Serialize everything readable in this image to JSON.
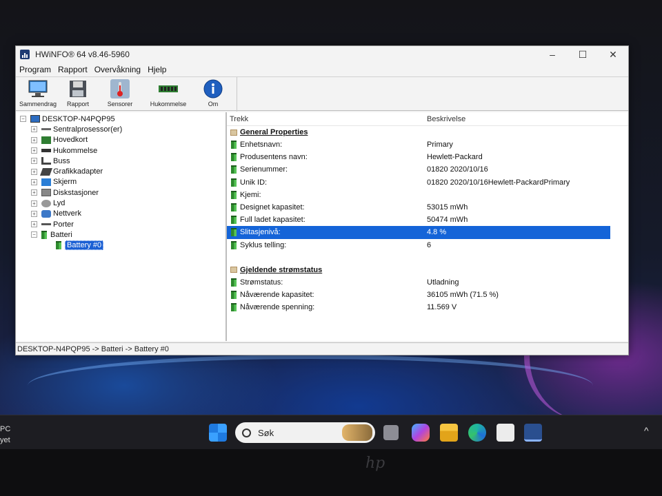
{
  "window": {
    "title": "HWiNFO® 64 v8.46-5960",
    "controls": {
      "minimize": "–",
      "maximize": "☐",
      "close": "✕"
    }
  },
  "menu": [
    "Program",
    "Rapport",
    "Overvåkning",
    "Hjelp"
  ],
  "toolbar": [
    {
      "label": "Sammendrag",
      "icon": "monitor-icon"
    },
    {
      "label": "Rapport",
      "icon": "floppy-disk-icon"
    },
    {
      "label": "Sensorer",
      "icon": "thermometer-icon"
    },
    {
      "label": "Hukommelse",
      "icon": "memory-module-icon"
    },
    {
      "label": "Om",
      "icon": "info-icon"
    }
  ],
  "tree": {
    "root": "DESKTOP-N4PQP95",
    "items": [
      {
        "label": "Sentralprosessor(er)",
        "icon": "cpu-icon"
      },
      {
        "label": "Hovedkort",
        "icon": "motherboard-icon"
      },
      {
        "label": "Hukommelse",
        "icon": "memory-icon"
      },
      {
        "label": "Buss",
        "icon": "bus-icon"
      },
      {
        "label": "Grafikkadapter",
        "icon": "gpu-icon"
      },
      {
        "label": "Skjerm",
        "icon": "display-icon"
      },
      {
        "label": "Diskstasjoner",
        "icon": "disk-icon"
      },
      {
        "label": "Lyd",
        "icon": "speaker-icon"
      },
      {
        "label": "Nettverk",
        "icon": "network-icon"
      },
      {
        "label": "Porter",
        "icon": "ports-icon"
      },
      {
        "label": "Batteri",
        "icon": "battery-icon"
      }
    ],
    "selected_child": "Battery #0"
  },
  "detail": {
    "col_headers": [
      "Trekk",
      "Beskrivelse"
    ],
    "groups": [
      {
        "title": "General Properties",
        "rows": [
          {
            "label": "Enhetsnavn:",
            "value": "Primary"
          },
          {
            "label": "Produsentens navn:",
            "value": "Hewlett-Packard"
          },
          {
            "label": "Serienummer:",
            "value": "01820 2020/10/16"
          },
          {
            "label": "Unik ID:",
            "value": "01820 2020/10/16Hewlett-PackardPrimary"
          },
          {
            "label": "Kjemi:",
            "value": ""
          },
          {
            "label": "Designet kapasitet:",
            "value": "53015 mWh"
          },
          {
            "label": "Full ladet kapasitet:",
            "value": "50474 mWh"
          },
          {
            "label": "Slitasjenivå:",
            "value": "4.8 %"
          },
          {
            "label": "Syklus telling:",
            "value": "6"
          }
        ]
      },
      {
        "title": "Gjeldende strømstatus",
        "rows": [
          {
            "label": "Strømstatus:",
            "value": "Utladning"
          },
          {
            "label": "Nåværende kapasitet:",
            "value": "36105 mWh (71.5 %)"
          },
          {
            "label": "Nåværende spenning:",
            "value": "11.569 V"
          }
        ]
      }
    ]
  },
  "statusbar": "DESKTOP-N4PQP95 -> Batteri -> Battery #0",
  "taskbar": {
    "search_placeholder": "Søk",
    "tray_text_lines": [
      "PC",
      "yet"
    ],
    "apps": [
      "windows-start-icon",
      "task-view-icon",
      "copilot-icon",
      "file-explorer-icon",
      "edge-icon",
      "store-icon",
      "hwinfo-icon"
    ]
  },
  "colors": {
    "selection": "#1464d8",
    "window_bg": "#f3f3f3",
    "taskbar_bg": "#1d1d22"
  }
}
